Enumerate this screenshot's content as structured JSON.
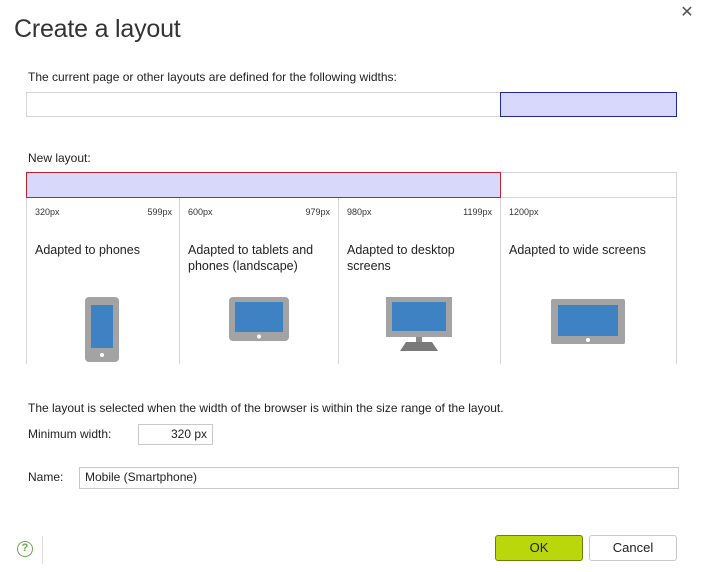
{
  "dialog": {
    "title": "Create a layout",
    "close_glyph": "✕",
    "current_label": "The current page or other layouts are defined for the following widths:",
    "new_label": "New layout:",
    "columns": [
      {
        "min": "320px",
        "max": "599px",
        "desc": "Adapted to phones",
        "icon": "phone-icon"
      },
      {
        "min": "600px",
        "max": "979px",
        "desc": "Adapted to tablets and phones (landscape)",
        "icon": "tablet-icon"
      },
      {
        "min": "980px",
        "max": "1199px",
        "desc": "Adapted to desktop screens",
        "icon": "desktop-monitor-icon"
      },
      {
        "min": "1200px",
        "max": "",
        "desc": "Adapted to wide screens",
        "icon": "wide-screen-icon"
      }
    ],
    "info_text": "The layout is selected when the width of the browser is within the size range of the layout.",
    "min_width_label": "Minimum width:",
    "min_width_value": "320 px",
    "name_label": "Name:",
    "name_value": "Mobile (Smartphone)",
    "help_glyph": "?",
    "ok_label": "OK",
    "cancel_label": "Cancel"
  },
  "colors": {
    "selected_fill": "#d8d8fb",
    "current_border": "#22289c",
    "new_border": "#c21f2f",
    "device_gray": "#a3a3a3",
    "device_screen": "#3e82c4",
    "ok_button": "#b9d70b"
  }
}
